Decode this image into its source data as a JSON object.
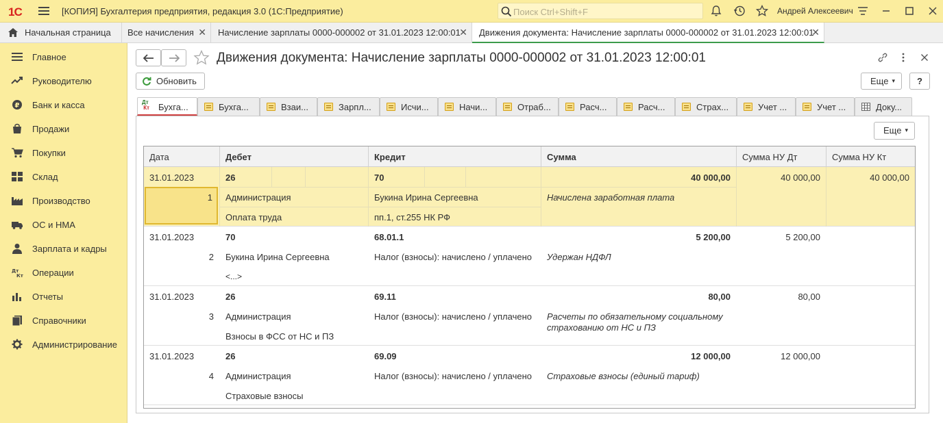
{
  "titlebar": {
    "logo": "1С",
    "app_title": "[КОПИЯ] Бухгалтерия предприятия, редакция 3.0  (1С:Предприятие)",
    "search_placeholder": "Поиск Ctrl+Shift+F",
    "user": "Андрей Алексеевич"
  },
  "tabs": [
    {
      "label": "Начальная страница"
    },
    {
      "label": "Все начисления"
    },
    {
      "label": "Начисление зарплаты 0000-000002 от 31.01.2023 12:00:01"
    },
    {
      "label": "Движения документа: Начисление зарплаты 0000-000002 от 31.01.2023 12:00:01"
    }
  ],
  "sidebar": {
    "items": [
      {
        "label": "Главное"
      },
      {
        "label": "Руководителю"
      },
      {
        "label": "Банк и касса"
      },
      {
        "label": "Продажи"
      },
      {
        "label": "Покупки"
      },
      {
        "label": "Склад"
      },
      {
        "label": "Производство"
      },
      {
        "label": "ОС и НМА"
      },
      {
        "label": "Зарплата и кадры"
      },
      {
        "label": "Операции"
      },
      {
        "label": "Отчеты"
      },
      {
        "label": "Справочники"
      },
      {
        "label": "Администрирование"
      }
    ]
  },
  "main": {
    "title": "Движения документа: Начисление зарплаты 0000-000002 от 31.01.2023 12:00:01",
    "refresh_label": "Обновить",
    "more_label": "Еще",
    "help_label": "?",
    "more2_label": "Еще",
    "dtkt_icon_text": "Дт Кт",
    "register_tabs": [
      {
        "label": "Бухга..."
      },
      {
        "label": "Бухга..."
      },
      {
        "label": "Взаи..."
      },
      {
        "label": "Зарпл..."
      },
      {
        "label": "Исчи..."
      },
      {
        "label": "Начи..."
      },
      {
        "label": "Отраб..."
      },
      {
        "label": "Расч..."
      },
      {
        "label": "Расч..."
      },
      {
        "label": "Страх..."
      },
      {
        "label": "Учет ..."
      },
      {
        "label": "Учет ..."
      },
      {
        "label": "Доку..."
      }
    ]
  },
  "table": {
    "headers": [
      "Дата",
      "Дебет",
      "Кредит",
      "Сумма",
      "Сумма НУ Дт",
      "Сумма НУ Кт"
    ],
    "rows": [
      {
        "date": "31.01.2023",
        "num": "1",
        "debit": "26",
        "debit_sub1": "Администрация",
        "debit_sub2": "Оплата труда",
        "credit": "70",
        "credit_sub1": "Букина Ирина Сергеевна",
        "credit_sub2": "пп.1, ст.255 НК РФ",
        "sum": "40 000,00",
        "content": "Начислена заработная плата",
        "content2": "",
        "nu_dt": "40 000,00",
        "nu_kt": "40 000,00"
      },
      {
        "date": "31.01.2023",
        "num": "2",
        "debit": "70",
        "debit_sub1": "Букина Ирина Сергеевна",
        "debit_sub2": "<...>",
        "credit": "68.01.1",
        "credit_sub1": "Налог (взносы): начислено / уплачено",
        "credit_sub2": "",
        "sum": "5 200,00",
        "content": "Удержан НДФЛ",
        "content2": "",
        "nu_dt": "5 200,00",
        "nu_kt": ""
      },
      {
        "date": "31.01.2023",
        "num": "3",
        "debit": "26",
        "debit_sub1": "Администрация",
        "debit_sub2": "Взносы в ФСС от НС и ПЗ",
        "credit": "69.11",
        "credit_sub1": "Налог (взносы): начислено / уплачено",
        "credit_sub2": "",
        "sum": "80,00",
        "content": "Расчеты по обязательному социальному",
        "content2": "страхованию от НС и ПЗ",
        "nu_dt": "80,00",
        "nu_kt": ""
      },
      {
        "date": "31.01.2023",
        "num": "4",
        "debit": "26",
        "debit_sub1": "Администрация",
        "debit_sub2": "Страховые взносы",
        "credit": "69.09",
        "credit_sub1": "Налог (взносы): начислено / уплачено",
        "credit_sub2": "",
        "sum": "12 000,00",
        "content": "Страховые взносы (единый тариф)",
        "content2": "",
        "nu_dt": "12 000,00",
        "nu_kt": ""
      }
    ]
  }
}
